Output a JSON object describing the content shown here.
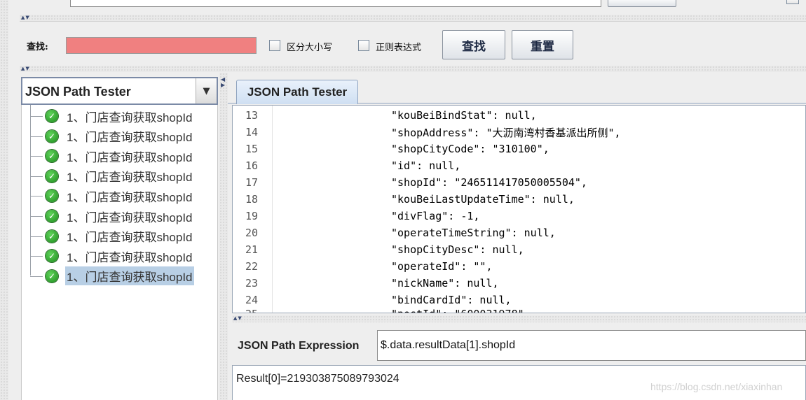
{
  "search": {
    "label": "查找:",
    "value": "",
    "case_label": "区分大小写",
    "regex_label": "正则表达式",
    "find_button": "查找",
    "reset_button": "重置"
  },
  "left_panel": {
    "selector_value": "JSON Path Tester",
    "tree_items": [
      {
        "label": "1、门店查询获取shopId",
        "selected": false
      },
      {
        "label": "1、门店查询获取shopId",
        "selected": false
      },
      {
        "label": "1、门店查询获取shopId",
        "selected": false
      },
      {
        "label": "1、门店查询获取shopId",
        "selected": false
      },
      {
        "label": "1、门店查询获取shopId",
        "selected": false
      },
      {
        "label": "1、门店查询获取shopId",
        "selected": false
      },
      {
        "label": "1、门店查询获取shopId",
        "selected": false
      },
      {
        "label": "1、门店查询获取shopId",
        "selected": false
      },
      {
        "label": "1、门店查询获取shopId",
        "selected": true
      }
    ]
  },
  "right_panel": {
    "tab_label": "JSON Path Tester",
    "code_lines": [
      {
        "num": "13",
        "text": "\"kouBeiBindStat\": null,"
      },
      {
        "num": "14",
        "text": "\"shopAddress\": \"大沥南湾村香基派出所侧\","
      },
      {
        "num": "15",
        "text": "\"shopCityCode\": \"310100\","
      },
      {
        "num": "16",
        "text": "\"id\": null,"
      },
      {
        "num": "17",
        "text": "\"shopId\": \"246511417050005504\","
      },
      {
        "num": "18",
        "text": "\"kouBeiLastUpdateTime\": null,"
      },
      {
        "num": "19",
        "text": "\"divFlag\": -1,"
      },
      {
        "num": "20",
        "text": "\"operateTimeString\": null,"
      },
      {
        "num": "21",
        "text": "\"shopCityDesc\": null,"
      },
      {
        "num": "22",
        "text": "\"operateId\": \"\","
      },
      {
        "num": "23",
        "text": "\"nickName\": null,"
      },
      {
        "num": "24",
        "text": "\"bindCardId\": null,"
      }
    ],
    "expression_label": "JSON Path Expression",
    "expression_value": "$.data.resultData[1].shopId",
    "result_text": "Result[0]=219303875089793024"
  },
  "watermark": "https://blog.csdn.net/xiaxinhan",
  "colors": {
    "search_field_bg": "#f08080",
    "selected_bg": "#b8cfe5",
    "shield_green": "#2aa02a"
  }
}
